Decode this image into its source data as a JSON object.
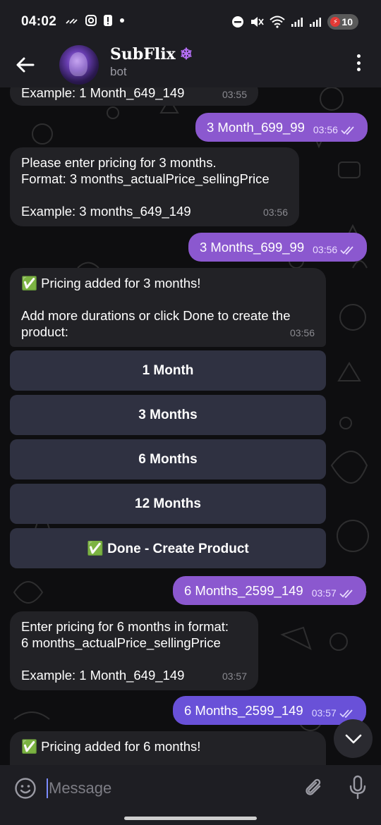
{
  "status_bar": {
    "time": "04:02",
    "battery_level": "10",
    "left_icons": [
      "signal-wave-icon",
      "instagram-icon",
      "alert-icon",
      "dot-icon"
    ],
    "right_icons": [
      "do-not-disturb-icon",
      "mute-icon",
      "wifi-icon",
      "cell-signal-icon",
      "cell-signal-icon-2",
      "battery-icon"
    ]
  },
  "header": {
    "title": "SubFlix",
    "title_emoji": "❄",
    "subtitle": "bot"
  },
  "messages": [
    {
      "type": "in",
      "text": "Example: 1 Month_649_149",
      "time": "03:55"
    },
    {
      "type": "out",
      "text": "3 Month_699_99",
      "time": "03:56"
    },
    {
      "type": "in",
      "text": "Please enter pricing for 3 months.\nFormat: 3 months_actualPrice_sellingPrice\n\nExample: 3 months_649_149",
      "time": "03:56"
    },
    {
      "type": "out",
      "text": "3 Months_699_99",
      "time": "03:56"
    },
    {
      "type": "in",
      "text": "✅ Pricing added for 3 months!\n\nAdd more durations or click Done to create the product:",
      "time": "03:56"
    },
    {
      "type": "out",
      "text": "6 Months_2599_149",
      "time": "03:57"
    },
    {
      "type": "in",
      "text": "Enter pricing for 6 months in format:\n6 months_actualPrice_sellingPrice\n\nExample: 1 Month_649_149",
      "time": "03:57"
    },
    {
      "type": "out",
      "text": "6 Months_2599_149",
      "time": "03:57"
    },
    {
      "type": "in",
      "text": "✅ Pricing added for 6 months!",
      "time": ""
    }
  ],
  "keyboard_buttons": [
    "1 Month",
    "3 Months",
    "6 Months",
    "12 Months",
    "✅ Done - Create Product"
  ],
  "composer": {
    "placeholder": "Message"
  },
  "colors": {
    "outgoing_bubble": "#8b58cf",
    "outgoing_bubble_latest": "#6951d8",
    "incoming_bubble": "#222226",
    "keyboard_button": "#2f3141",
    "header_bg": "#1d1d22"
  }
}
